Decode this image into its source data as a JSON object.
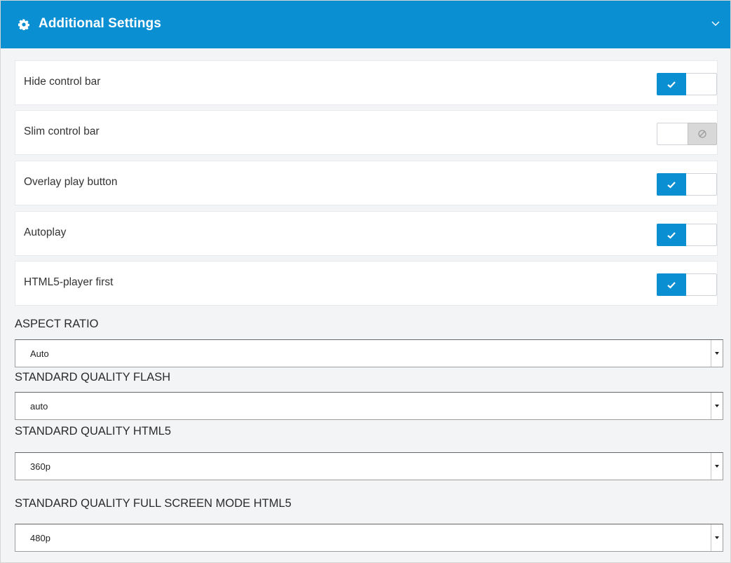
{
  "header": {
    "title": "Additional Settings",
    "icon": "gear-icon",
    "collapse_icon": "chevron-down-icon",
    "color": "#0a8fd3"
  },
  "toggles": [
    {
      "label": "Hide control bar",
      "state": "on"
    },
    {
      "label": "Slim control bar",
      "state": "off"
    },
    {
      "label": "Overlay play button",
      "state": "on"
    },
    {
      "label": "Autoplay",
      "state": "on"
    },
    {
      "label": "HTML5-player first",
      "state": "on"
    }
  ],
  "selects": [
    {
      "label": "ASPECT RATIO",
      "value": "Auto"
    },
    {
      "label": "STANDARD QUALITY FLASH",
      "value": "auto"
    },
    {
      "label": "STANDARD QUALITY HTML5",
      "value": "360p"
    },
    {
      "label": "STANDARD QUALITY FULL SCREEN MODE HTML5",
      "value": "480p"
    }
  ],
  "colors": {
    "accent": "#0a8fd3",
    "toggle_off": "#d8d8d8"
  }
}
